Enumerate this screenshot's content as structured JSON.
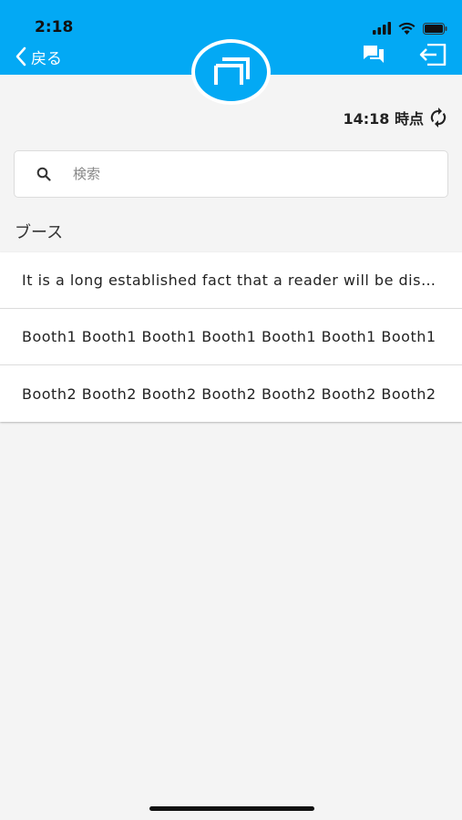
{
  "status_bar": {
    "time": "2:18"
  },
  "header": {
    "back_label": "戻る",
    "icons": [
      "chat-icon",
      "logout-icon",
      "app-logo-icon"
    ]
  },
  "sync": {
    "label": "14:18 時点"
  },
  "search": {
    "placeholder": "検索",
    "value": ""
  },
  "section": {
    "title": "ブース"
  },
  "list": {
    "items": [
      {
        "label": "It is a long established fact that a reader will be distracted"
      },
      {
        "label": "Booth1 Booth1 Booth1 Booth1 Booth1 Booth1 Booth1"
      },
      {
        "label": "Booth2 Booth2 Booth2 Booth2 Booth2 Booth2 Booth2"
      }
    ]
  },
  "colors": {
    "primary": "#03a9f4",
    "background": "#f4f4f4"
  }
}
